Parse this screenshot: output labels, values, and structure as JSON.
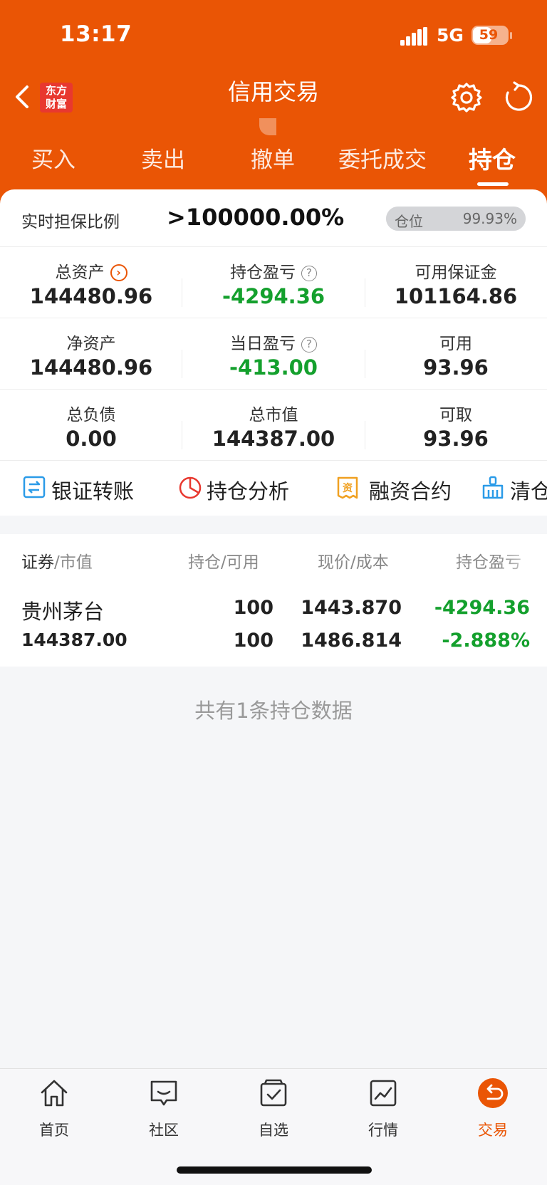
{
  "status_bar": {
    "time": "13:17",
    "network": "5G",
    "battery": "59",
    "battery_level": 0.59
  },
  "nav": {
    "title": "信用交易",
    "logo_line1": "东方",
    "logo_line2": "财富"
  },
  "tabs": [
    {
      "label": "买入"
    },
    {
      "label": "卖出"
    },
    {
      "label": "撤单"
    },
    {
      "label": "委托成交"
    },
    {
      "label": "持仓"
    }
  ],
  "ratio": {
    "label": "实时担保比例",
    "value": ">100000.00%"
  },
  "position_pill": {
    "label": "仓位",
    "value": "99.93%",
    "level": 0.9993
  },
  "metrics": {
    "total_assets": {
      "label": "总资产",
      "value": "144480.96"
    },
    "holding_pnl": {
      "label": "持仓盈亏",
      "value": "-4294.36"
    },
    "available_margin": {
      "label": "可用保证金",
      "value": "101164.86"
    },
    "net_assets": {
      "label": "净资产",
      "value": "144480.96"
    },
    "daily_pnl": {
      "label": "当日盈亏",
      "value": "-413.00"
    },
    "available": {
      "label": "可用",
      "value": "93.96"
    },
    "total_liabilities": {
      "label": "总负债",
      "value": "0.00"
    },
    "total_market_value": {
      "label": "总市值",
      "value": "144387.00"
    },
    "withdrawable": {
      "label": "可取",
      "value": "93.96"
    }
  },
  "quick_actions": [
    {
      "label": "银证转账"
    },
    {
      "label": "持仓分析"
    },
    {
      "label": "融资合约"
    },
    {
      "label": "清仓"
    }
  ],
  "holdings_header": {
    "security": "证券",
    "market_value": "/市值",
    "position": "持仓",
    "available": "/可用",
    "price": "现价",
    "cost": "/成本",
    "pnl": "持仓盈亏"
  },
  "holdings": [
    {
      "name": "贵州茅台",
      "market_value": "144387.00",
      "position": "100",
      "available": "100",
      "price": "1443.870",
      "cost": "1486.814",
      "pnl": "-4294.36",
      "pnl_pct": "-2.888%"
    }
  ],
  "summary": "共有1条持仓数据",
  "bottom_nav": [
    {
      "label": "首页"
    },
    {
      "label": "社区"
    },
    {
      "label": "自选"
    },
    {
      "label": "行情"
    },
    {
      "label": "交易"
    }
  ],
  "colors": {
    "brand": "#ea5505",
    "loss": "#14a02d"
  }
}
